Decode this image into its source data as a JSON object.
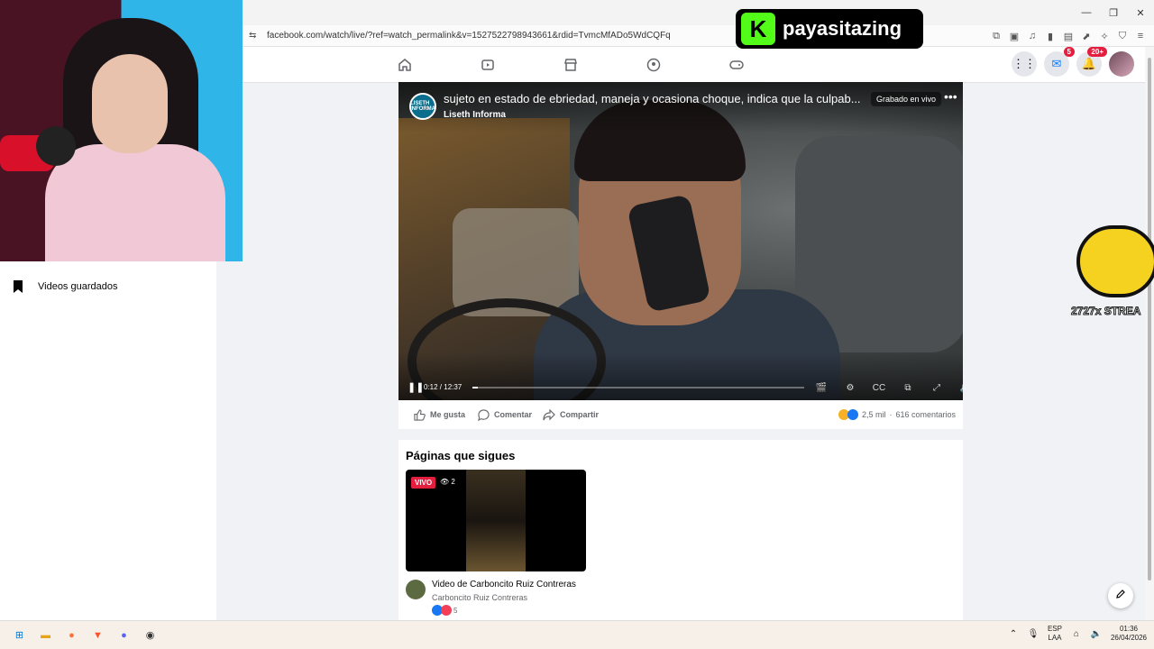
{
  "browser": {
    "url": "facebook.com/watch/live/?ref=watch_permalink&v=1527522798943661&rdid=TvmcMfADo5WdCQFq"
  },
  "nav": {
    "messenger_badge": "5",
    "notifications_badge": "20+"
  },
  "sidebar": {
    "saved_videos_label": "Videos guardados"
  },
  "video": {
    "title": "sujeto en estado de ebriedad, maneja y ocasiona choque, indica que la culpab...",
    "channel": "Liseth Informa",
    "logo_text": "LISETH INFORMA",
    "status": "Grabado en vivo",
    "time": "0:12 / 12:37",
    "progress": 0.016
  },
  "actions": {
    "like": "Me gusta",
    "comment": "Comentar",
    "share": "Compartir",
    "reactions_count": "2,5 mil",
    "separator": "·",
    "comments_count": "616 comentarios"
  },
  "pages_section": {
    "title": "Páginas que sigues",
    "card": {
      "live_label": "VIVO",
      "viewers": "2",
      "title": "Video de Carboncito Ruiz Contreras",
      "subtitle": "Carboncito Ruiz Contreras",
      "reactions": "5"
    }
  },
  "overlays": {
    "kick_logo_letter": "K",
    "kick_username": "payasitazing",
    "bee_text": "2727x STREA"
  },
  "taskbar": {
    "lang_line1": "ESP",
    "lang_line2": "LAA",
    "time": "01:36",
    "date": "26/04/2026"
  },
  "colors": {
    "fb_blue": "#1877f2",
    "kick_green": "#53fc18",
    "live_red": "#e41e3f"
  }
}
